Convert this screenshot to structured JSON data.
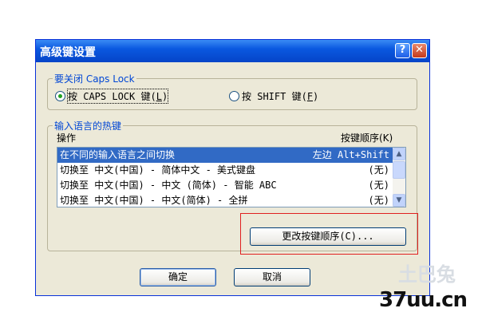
{
  "window": {
    "title": "高级键设置",
    "help_glyph": "?",
    "close_glyph": "✕"
  },
  "caps_group": {
    "legend": "要关闭 Caps Lock",
    "option1": {
      "prefix": "按 CAPS LOCK 键(",
      "key": "L",
      "suffix": ")",
      "selected": true
    },
    "option2": {
      "prefix": "按 SHIFT 键(",
      "key": "F",
      "suffix": ")",
      "selected": false
    }
  },
  "hotkey_group": {
    "legend": "输入语言的热键",
    "col_operation": "操作",
    "col_sequence": "按键顺序(K)",
    "rows": [
      {
        "operation": "在不同的输入语言之间切换",
        "sequence": "左边 Alt+Shift",
        "selected": true
      },
      {
        "operation": "切换至 中文(中国) - 简体中文 - 美式键盘",
        "sequence": "(无)",
        "selected": false
      },
      {
        "operation": "切换至 中文(中国) - 中文 (简体) - 智能 ABC",
        "sequence": "(无)",
        "selected": false
      },
      {
        "operation": "切换至 中文(中国) - 中文(简体) - 全拼",
        "sequence": "(无)",
        "selected": false
      }
    ],
    "change_button": "更改按键顺序(C)..."
  },
  "buttons": {
    "ok": "确定",
    "cancel": "取消"
  },
  "watermark": {
    "text": "37uu.cn",
    "faint": "土巴兔"
  }
}
